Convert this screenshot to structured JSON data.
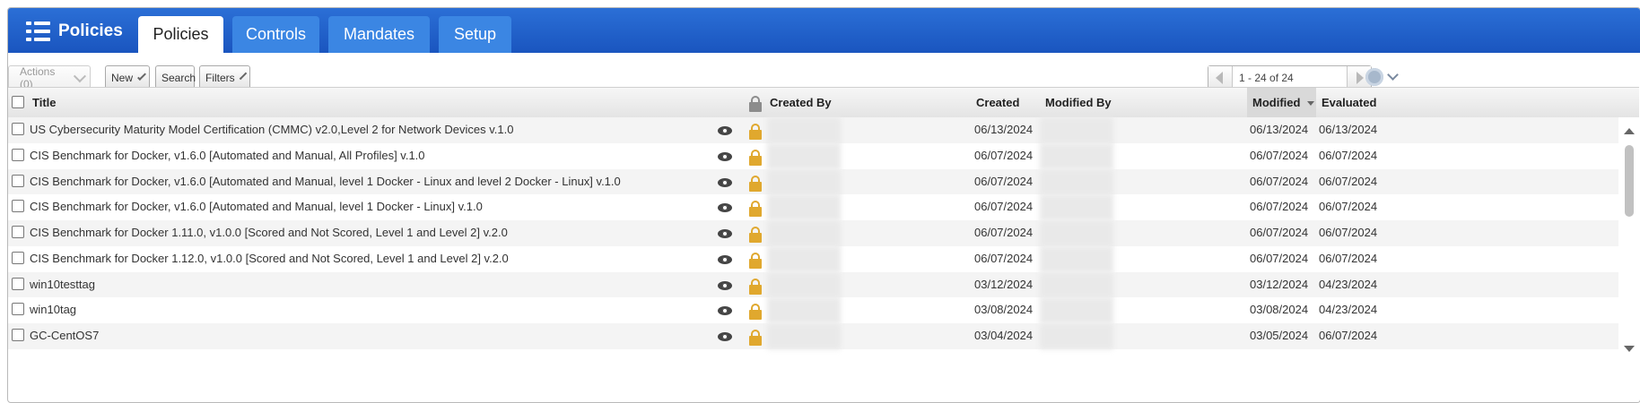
{
  "app": {
    "title": "Policies"
  },
  "tabs": [
    {
      "label": "Policies",
      "active": true
    },
    {
      "label": "Controls",
      "active": false
    },
    {
      "label": "Mandates",
      "active": false
    },
    {
      "label": "Setup",
      "active": false
    }
  ],
  "toolbar": {
    "actions_label": "Actions (0)",
    "new_label": "New",
    "search_label": "Search",
    "filters_label": "Filters",
    "pager_range": "1 - 24 of 24"
  },
  "columns": {
    "title": "Title",
    "created_by": "Created By",
    "created": "Created",
    "modified_by": "Modified By",
    "modified": "Modified",
    "evaluated": "Evaluated"
  },
  "rows": [
    {
      "title": "US Cybersecurity Maturity Model Certification (CMMC) v2.0,Level 2 for Network Devices v.1.0",
      "created": "06/13/2024",
      "modified": "06/13/2024",
      "evaluated": "06/13/2024"
    },
    {
      "title": "CIS Benchmark for Docker, v1.6.0 [Automated and Manual, All Profiles] v.1.0",
      "created": "06/07/2024",
      "modified": "06/07/2024",
      "evaluated": "06/07/2024"
    },
    {
      "title": "CIS Benchmark for Docker, v1.6.0 [Automated and Manual, level 1 Docker - Linux and level 2 Docker - Linux] v.1.0",
      "created": "06/07/2024",
      "modified": "06/07/2024",
      "evaluated": "06/07/2024"
    },
    {
      "title": "CIS Benchmark for Docker, v1.6.0 [Automated and Manual, level 1 Docker - Linux] v.1.0",
      "created": "06/07/2024",
      "modified": "06/07/2024",
      "evaluated": "06/07/2024"
    },
    {
      "title": "CIS Benchmark for Docker 1.11.0, v1.0.0 [Scored and Not Scored, Level 1 and Level 2] v.2.0",
      "created": "06/07/2024",
      "modified": "06/07/2024",
      "evaluated": "06/07/2024"
    },
    {
      "title": "CIS Benchmark for Docker 1.12.0, v1.0.0 [Scored and Not Scored, Level 1 and Level 2] v.2.0",
      "created": "06/07/2024",
      "modified": "06/07/2024",
      "evaluated": "06/07/2024"
    },
    {
      "title": "win10testtag",
      "created": "03/12/2024",
      "modified": "03/12/2024",
      "evaluated": "04/23/2024"
    },
    {
      "title": "win10tag",
      "created": "03/08/2024",
      "modified": "03/08/2024",
      "evaluated": "04/23/2024"
    },
    {
      "title": "GC-CentOS7",
      "created": "03/04/2024",
      "modified": "03/05/2024",
      "evaluated": "06/07/2024"
    }
  ],
  "icons": {
    "header": "list-icon",
    "row_view": "eye-icon",
    "row_lock": "lock-icon",
    "settings": "gear-icon"
  },
  "colors": {
    "header_blue": "#1a55bf",
    "tab_blue": "#3b86e3",
    "lock_gold": "#e0a82e"
  }
}
